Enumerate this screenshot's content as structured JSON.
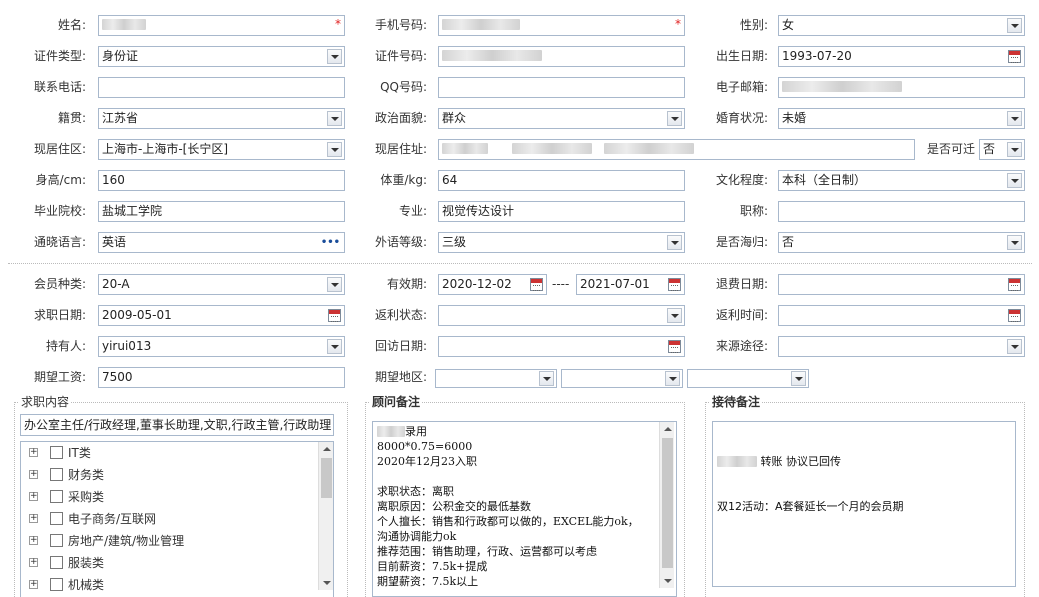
{
  "labels": {
    "name": "姓名:",
    "mobile": "手机号码:",
    "gender": "性别:",
    "id_type": "证件类型:",
    "id_number": "证件号码:",
    "birth_date": "出生日期:",
    "contact_phone": "联系电话:",
    "qq": "QQ号码:",
    "email": "电子邮箱:",
    "native_place": "籍贯:",
    "political_status": "政治面貌:",
    "marital_status": "婚育状况:",
    "residence_area": "现居住区:",
    "residence_address": "现居住址:",
    "relocatable": "是否可迁",
    "height": "身高/cm:",
    "weight": "体重/kg:",
    "education": "文化程度:",
    "school": "毕业院校:",
    "major": "专业:",
    "title": "职称:",
    "language": "通晓语言:",
    "foreign_level": "外语等级:",
    "overseas": "是否海归:",
    "member_type": "会员种类:",
    "valid_period": "有效期:",
    "refund_date": "退费日期:",
    "job_seek_date": "求职日期:",
    "rebate_status": "返利状态:",
    "rebate_time": "返利时间:",
    "holder": "持有人:",
    "visit_date": "回访日期:",
    "source": "来源途径:",
    "expected_salary": "期望工资:",
    "expected_region": "期望地区:",
    "period_sep": "----"
  },
  "values": {
    "gender": "女",
    "id_type": "身份证",
    "birth_date": "1993-07-20",
    "native_place": "江苏省",
    "political_status": "群众",
    "marital_status": "未婚",
    "residence_area": "上海市-上海市-[长宁区]",
    "relocatable": "否",
    "height": "160",
    "weight": "64",
    "education": "本科（全日制）",
    "school": "盐城工学院",
    "major": "视觉传达设计",
    "language": "英语",
    "language_more": "•••",
    "foreign_level": "三级",
    "overseas": "否",
    "member_type": "20-A",
    "valid_from": "2020-12-02",
    "valid_to": "2021-07-01",
    "job_seek_date": "2009-05-01",
    "holder": "yirui013",
    "expected_salary": "7500"
  },
  "panels": {
    "job_content_title": "求职内容",
    "job_content_text": "办公室主任/行政经理,董事长助理,文职,行政主管,行政助理",
    "consultant_title": "顾问备注",
    "consultant_notes": "录用\n8000*0.75=6000\n2020年12月23入职\n\n求职状态：离职\n离职原因：公积金交的最低基数\n个人擅长：销售和行政都可以做的，EXCEL能力ok，\n沟通协调能力ok\n推荐范围：销售助理，行政、运营都可以考虑\n目前薪资：7.5k+提成\n期望薪资：7.5k以上",
    "reception_title": "接待备注",
    "reception_line1": "转账 协议已回传",
    "reception_line2": "双12活动：A套餐延长一个月的会员期"
  },
  "job_categories": [
    "IT类",
    "财务类",
    "采购类",
    "电子商务/互联网",
    "房地产/建筑/物业管理",
    "服装类",
    "机械类"
  ],
  "icons": {
    "dropdown": "chevron-down-icon",
    "calendar": "calendar-icon",
    "expand": "plus-box-icon",
    "required": "asterisk-icon"
  },
  "colors": {
    "field_border": "#a8b8cc",
    "required": "#e02020"
  }
}
